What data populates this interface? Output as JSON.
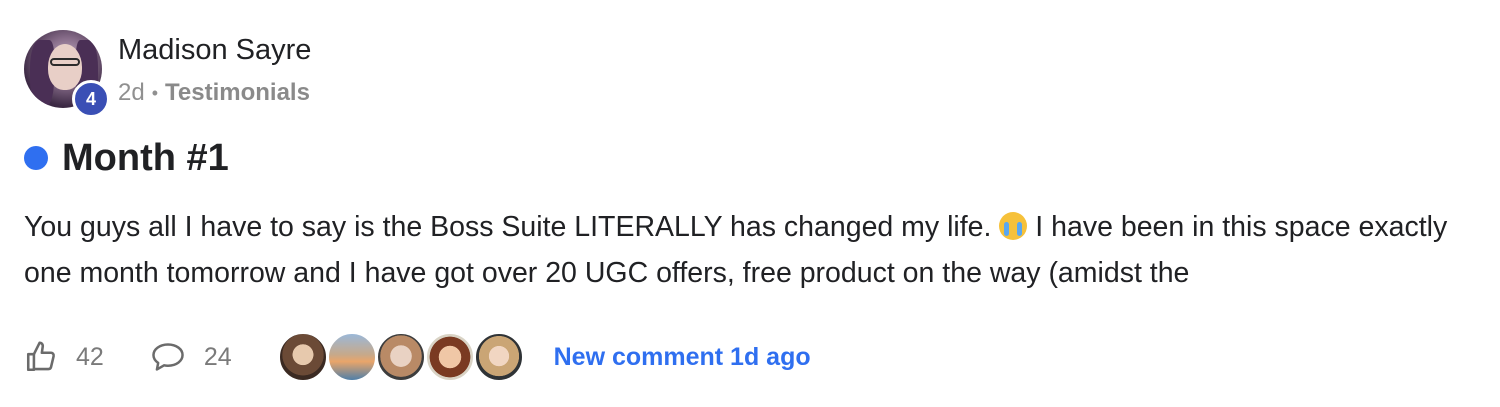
{
  "post": {
    "author": {
      "name": "Madison Sayre",
      "level": "4"
    },
    "meta": {
      "time_ago": "2d",
      "separator": "•",
      "category": "Testimonials"
    },
    "title": "Month #1",
    "body_part1": "You guys all I have to say is the Boss Suite LITERALLY has changed my life. ",
    "body_emoji_icon": "crying-face-emoji",
    "body_part2": " I have been in this space exactly one month tomorrow and I have got over 20 UGC offers, free product on the way (amidst the",
    "footer": {
      "likes_count": "42",
      "comments_count": "24",
      "new_comment_label": "New comment 1d ago",
      "commenter_count": 5
    }
  },
  "colors": {
    "accent_blue": "#2f6ff0",
    "level_badge": "#3a4fb5",
    "muted_text": "#909090"
  }
}
